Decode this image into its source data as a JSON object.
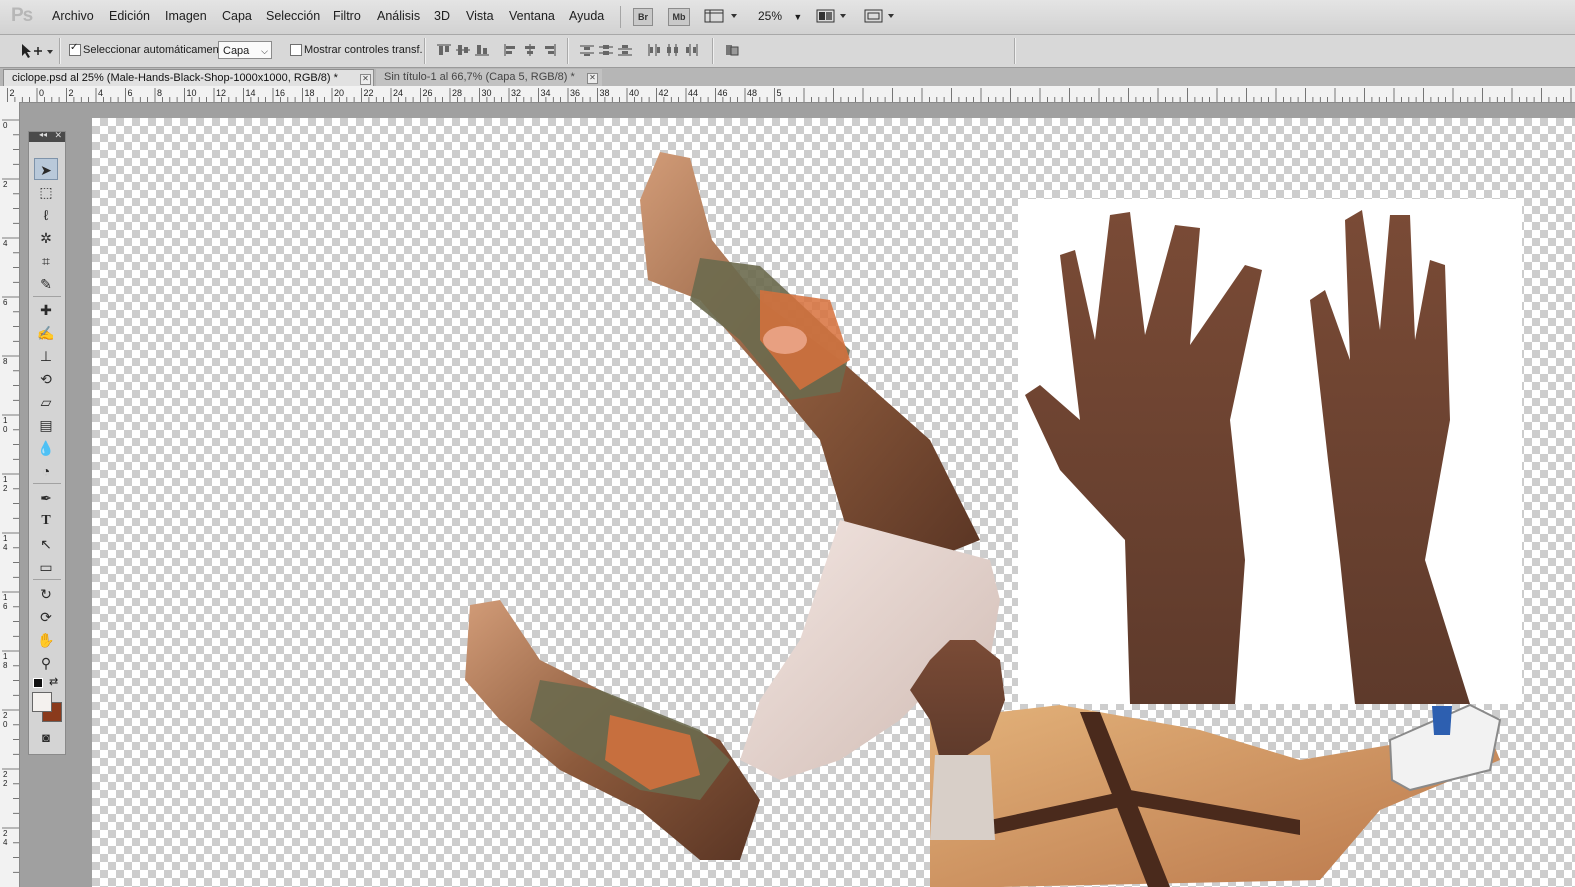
{
  "menubar": {
    "app_logo": "Ps",
    "items": [
      "Archivo",
      "Edición",
      "Imagen",
      "Capa",
      "Selección",
      "Filtro",
      "Análisis",
      "3D",
      "Vista",
      "Ventana",
      "Ayuda"
    ],
    "bridge_button": "Br",
    "minibridge_button": "Mb",
    "zoom_level": "25%"
  },
  "options_bar": {
    "auto_select_label": "Seleccionar automáticamente:",
    "auto_select_checked": true,
    "auto_select_target": "Capa",
    "show_transform_label": "Mostrar controles transf.",
    "show_transform_checked": false
  },
  "document_tabs": [
    {
      "label": "ciclope.psd al 25% (Male-Hands-Black-Shop-1000x1000, RGB/8) *",
      "active": true
    },
    {
      "label": "Sin título-1 al 66,7% (Capa 5, RGB/8) *",
      "active": false
    }
  ],
  "rulers": {
    "horizontal_labels": [
      "2",
      "0",
      "2",
      "4",
      "6",
      "8",
      "10",
      "12",
      "14",
      "16",
      "18",
      "20",
      "22",
      "24",
      "26",
      "28",
      "30",
      "32",
      "34",
      "36",
      "38",
      "40",
      "42",
      "44",
      "46",
      "48",
      "5"
    ],
    "vertical_labels": [
      "0",
      "2",
      "4",
      "6",
      "8",
      "10",
      "12",
      "14",
      "16",
      "18",
      "20",
      "22",
      "24"
    ]
  },
  "tools": [
    "move-tool",
    "marquee-tool",
    "lasso-tool",
    "quick-selection-tool",
    "crop-tool",
    "eyedropper-tool",
    "healing-brush-tool",
    "brush-tool",
    "clone-stamp-tool",
    "history-brush-tool",
    "eraser-tool",
    "gradient-tool",
    "blur-tool",
    "dodge-tool",
    "pen-tool",
    "type-tool",
    "path-selection-tool",
    "rectangle-tool",
    "3d-rotate-tool",
    "3d-orbit-tool",
    "hand-tool",
    "zoom-tool"
  ],
  "colors": {
    "foreground": "#f4f1ee",
    "background": "#8a3a1c",
    "skin_dark": "#6b4532",
    "skin_light": "#c48a62",
    "selection_accent": "#b9c9da"
  }
}
